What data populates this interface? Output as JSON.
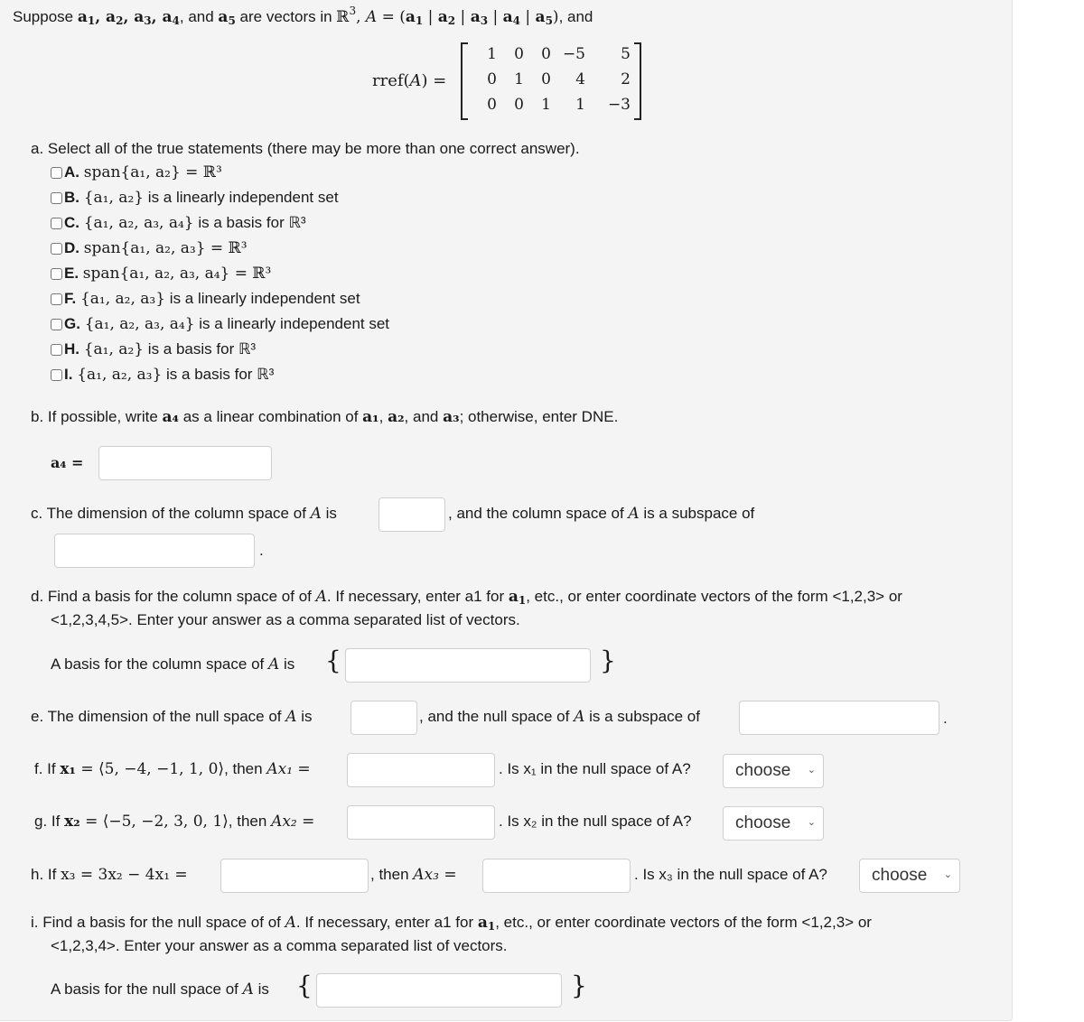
{
  "intro": {
    "prefix": "Suppose ",
    "vectors": "a",
    "mid": " are vectors in ",
    "space": "ℝ",
    "space_exp": "3",
    "matrix_def": "A = (a₁ | a₂ | a₃ | a₄ | a₅)",
    "suffix": ", and"
  },
  "rref": {
    "label": "rref(A) =",
    "rows": [
      [
        "1",
        "0",
        "0",
        "−5",
        "5"
      ],
      [
        "0",
        "1",
        "0",
        "4",
        "2"
      ],
      [
        "0",
        "0",
        "1",
        "1",
        "−3"
      ]
    ]
  },
  "part_a": {
    "prompt": "a. Select all of the true statements (there may be more than one correct answer).",
    "options": [
      {
        "letter": "A.",
        "math": "span{a₁, a₂} = ℝ³",
        "text": ""
      },
      {
        "letter": "B.",
        "math": "{a₁, a₂}",
        "text": " is a linearly independent set"
      },
      {
        "letter": "C.",
        "math": "{a₁, a₂, a₃, a₄}",
        "text": " is a basis for ℝ³"
      },
      {
        "letter": "D.",
        "math": "span{a₁, a₂, a₃} = ℝ³",
        "text": ""
      },
      {
        "letter": "E.",
        "math": "span{a₁, a₂, a₃, a₄} = ℝ³",
        "text": ""
      },
      {
        "letter": "F.",
        "math": "{a₁, a₂, a₃}",
        "text": " is a linearly independent set"
      },
      {
        "letter": "G.",
        "math": "{a₁, a₂, a₃, a₄}",
        "text": " is a linearly independent set"
      },
      {
        "letter": "H.",
        "math": "{a₁, a₂}",
        "text": " is a basis for ℝ³"
      },
      {
        "letter": "I.",
        "math": "{a₁, a₂, a₃}",
        "text": " is a basis for ℝ³"
      }
    ]
  },
  "part_b": {
    "prompt_1": "b. If possible, write ",
    "a4": "a₄",
    "prompt_2": " as a linear combination of ",
    "a1": "a₁",
    "a2": "a₂",
    "prompt_3": ", and ",
    "a3": "a₃",
    "prompt_4": "; otherwise, enter DNE.",
    "field_label": "a₄ =",
    "value": ""
  },
  "part_c": {
    "text_1": "c. The dimension of the column space of ",
    "A": "A",
    "text_2": " is",
    "text_3": ", and the column space of ",
    "text_4": " is a subspace of",
    "period": ".",
    "dim_value": "",
    "subspace_value": ""
  },
  "part_d": {
    "line_1a": "d. Find a basis for the column space of of ",
    "line_1b": ". If necessary, enter a1 for ",
    "line_1c": ", etc., or enter coordinate vectors of the form <1,2,3> or",
    "line_2": "<1,2,3,4,5>. Enter your answer as a comma separated list of vectors.",
    "basis_label_a": "A basis for the column space of ",
    "basis_label_b": " is",
    "value": ""
  },
  "part_e": {
    "text_1": "e. The dimension of the null space of ",
    "text_2": " is",
    "text_3": ", and the null space of ",
    "text_4": " is a subspace of",
    "period": ".",
    "dim_value": "",
    "subspace_value": ""
  },
  "part_f": {
    "prefix": "f. If ",
    "x": "x₁",
    "def": " = ⟨5, −4, −1, 1, 0⟩",
    "then": ", then ",
    "Ax": "Ax₁",
    "eq": " =",
    "question": ". Is x₁ in the null space of A?",
    "value": "",
    "select": "choose"
  },
  "part_g": {
    "prefix": "g. If ",
    "x": "x₂",
    "def": " = ⟨−5, −2, 3, 0, 1⟩",
    "then": ", then ",
    "Ax": "Ax₂",
    "eq": " =",
    "question": ". Is x₂ in the null space of A?",
    "value": "",
    "select": "choose"
  },
  "part_h": {
    "prefix": "h. If ",
    "expr": "x₃ = 3x₂ − 4x₁ =",
    "then": ", then ",
    "Ax": "Ax₃ =",
    "question": ". Is x₃ in the null space of A?",
    "x3_value": "",
    "ax3_value": "",
    "select": "choose"
  },
  "part_i": {
    "line_1a": "i. Find a basis for the null space of of ",
    "line_1b": ". If necessary, enter a1 for ",
    "line_1c": ", etc., or enter coordinate vectors of the form <1,2,3> or",
    "line_2": "<1,2,3,4>. Enter your answer as a comma separated list of vectors.",
    "basis_label_a": "A basis for the null space of ",
    "basis_label_b": " is",
    "value": ""
  },
  "select_options": [
    "choose"
  ],
  "brace_open": "{",
  "brace_close": "}"
}
